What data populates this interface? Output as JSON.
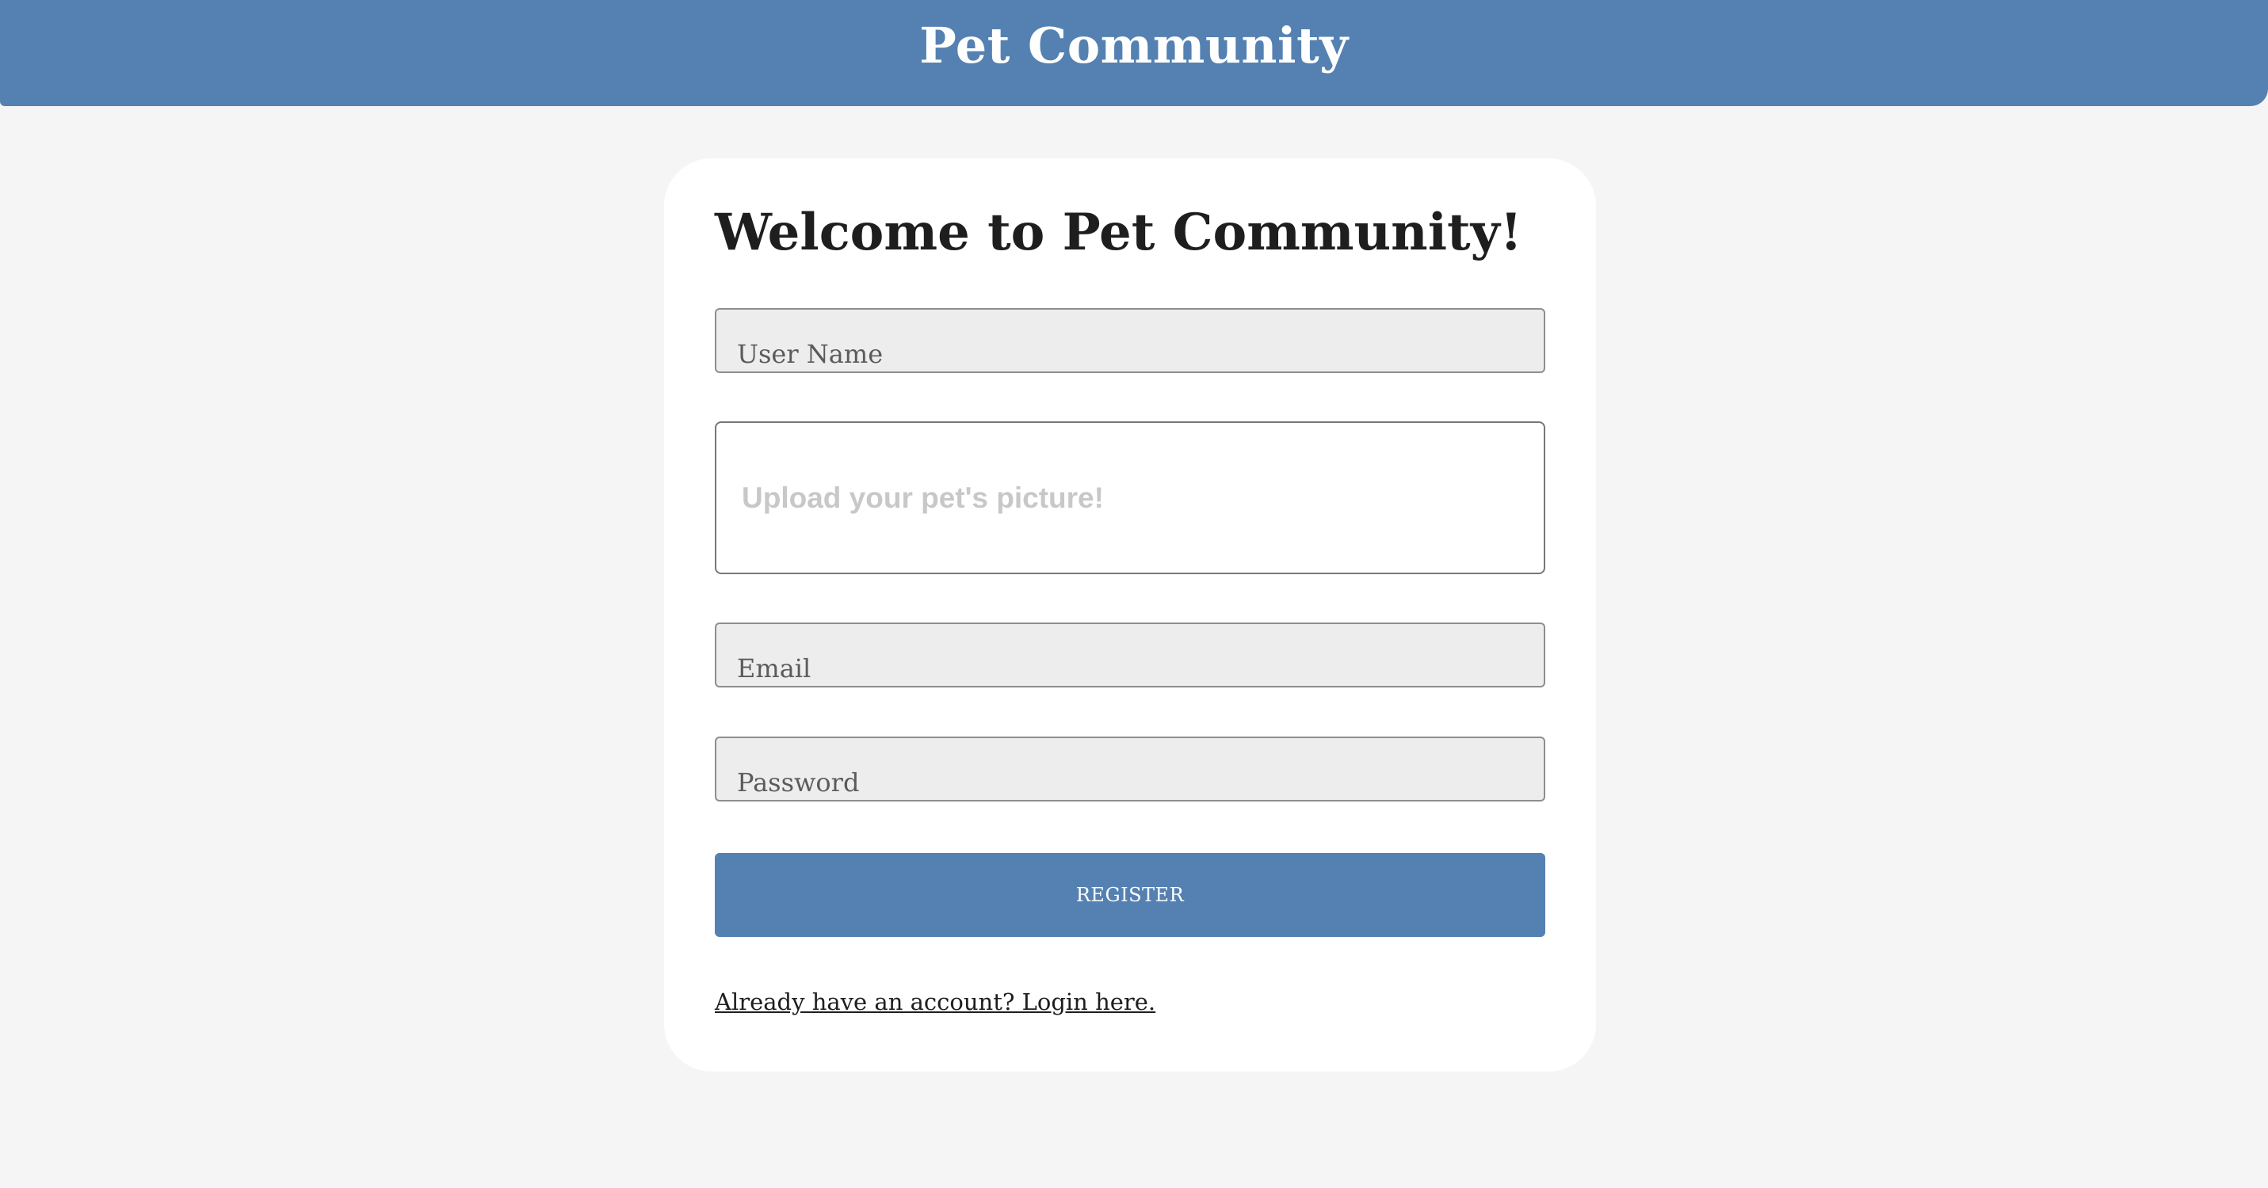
{
  "header": {
    "title": "Pet Community"
  },
  "form": {
    "heading": "Welcome to Pet Community!",
    "username_placeholder": "User Name",
    "upload_label": "Upload your pet's picture!",
    "email_placeholder": "Email",
    "password_placeholder": "Password",
    "register_label": "REGISTER",
    "login_link": "Already have an account? Login here."
  },
  "colors": {
    "brand": "#5481b2",
    "page_background": "#f5f5f5",
    "field_background": "#ededed"
  }
}
